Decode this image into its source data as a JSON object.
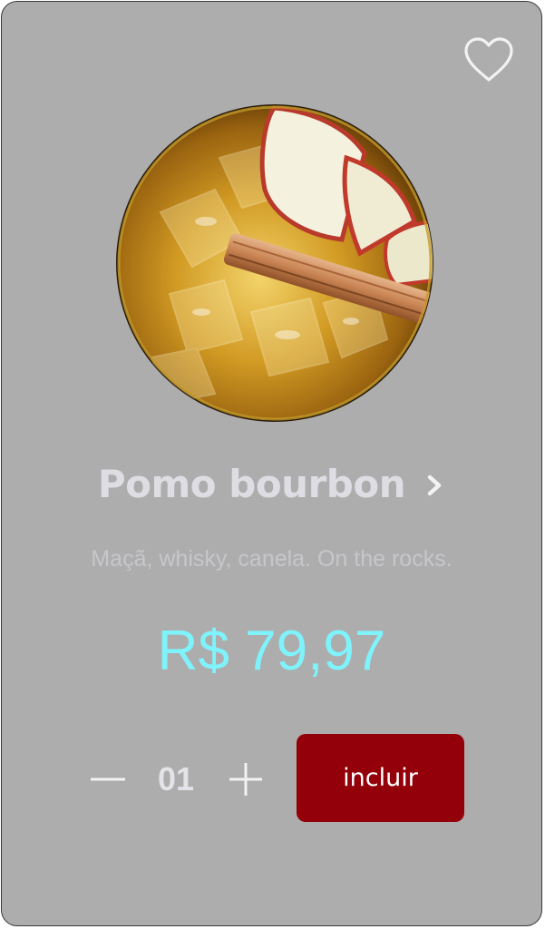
{
  "product": {
    "name": "Pomo bourbon",
    "description": "Maçã, whisky, canela. On the rocks.",
    "price": "R$ 79,97",
    "image_icon": "cocktail-glass-photo"
  },
  "favorite": {
    "icon": "heart-outline-icon",
    "active": false
  },
  "details": {
    "icon": "chevron-right-icon"
  },
  "quantity": {
    "value": "01",
    "decrement_icon": "minus-icon",
    "increment_icon": "plus-icon"
  },
  "add_button": {
    "label": "incluir"
  },
  "colors": {
    "card_background": "#adadad",
    "title": "#dedde3",
    "description": "#c6c6cc",
    "price": "#7ff3fb",
    "button": "#930009",
    "button_text": "#ffffff"
  }
}
